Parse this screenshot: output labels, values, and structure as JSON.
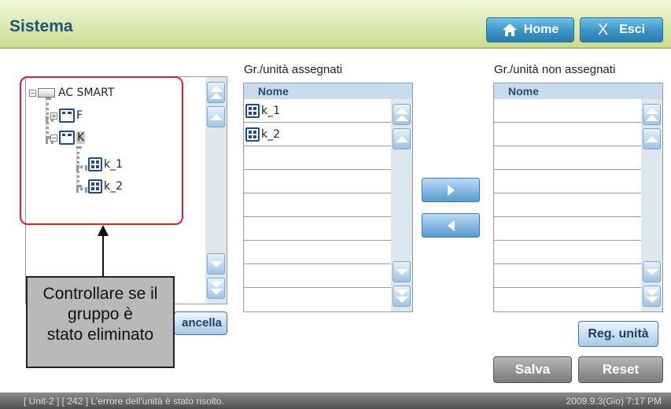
{
  "header": {
    "title": "Sistema",
    "home_label": "Home",
    "exit_glyph": "X",
    "exit_label": "Esci"
  },
  "tree": {
    "nodes": [
      {
        "label": "AC SMART",
        "icon": "ac-smart-icon",
        "expander": "−"
      },
      {
        "label": "F",
        "icon": "group-icon",
        "expander": "+"
      },
      {
        "label": "K",
        "icon": "group-icon",
        "expander": "−",
        "selected": true
      },
      {
        "label": "k_1",
        "icon": "unit-icon"
      },
      {
        "label": "k_2",
        "icon": "unit-icon"
      }
    ]
  },
  "callout": {
    "lines": [
      "Controllare se il",
      "gruppo è",
      "stato eliminato"
    ]
  },
  "cancel_label": "ancella",
  "assigned": {
    "title": "Gr./unità assegnati",
    "column": "Nome",
    "rows": [
      "k_1",
      "k_2"
    ]
  },
  "unassigned": {
    "title": "Gr./unità non assegnati",
    "column": "Nome",
    "rows": []
  },
  "buttons": {
    "register": "Reg. unità",
    "save": "Salva",
    "reset": "Reset"
  },
  "status": {
    "message": "[ Unit-2 ] [ 242 ] L'errore dell'unità è stato risolto.",
    "datetime": "2009.9.3(Gio)  7:17 PM"
  },
  "colors": {
    "header_green": "#dbe9b0",
    "title_blue": "#20527a",
    "highlight_red": "#e0222a"
  }
}
